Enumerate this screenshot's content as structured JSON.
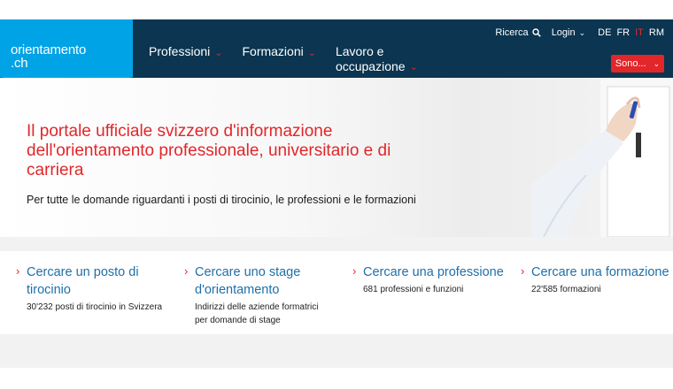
{
  "header": {
    "logo_line1": "orientamento",
    "logo_line2": ".ch",
    "nav": [
      {
        "label": "Professioni"
      },
      {
        "label": "Formazioni"
      },
      {
        "label_line1": "Lavoro e",
        "label_line2": "occupazione"
      }
    ],
    "util": {
      "search_label": "Ricerca",
      "login_label": "Login",
      "languages": [
        "DE",
        "FR",
        "IT",
        "RM"
      ],
      "active_language": "IT"
    },
    "sono_label": "Sono...",
    "colors": {
      "nav_bg": "#0b3550",
      "logo_bg": "#00a3e6",
      "accent": "#e2262a",
      "link": "#1f6fa8"
    }
  },
  "hero": {
    "title": "Il portale ufficiale svizzero d'informazione dell'orientamento professionale, universitario e di carriera",
    "subtitle": "Per tutte le domande riguardanti i posti di tirocinio, le professioni e le formazioni"
  },
  "quicklinks": [
    {
      "title": "Cercare un posto di tirocinio",
      "desc": "30'232 posti di tirocinio in Svizzera"
    },
    {
      "title": "Cercare uno stage d'orientamento",
      "desc": "Indirizzi delle aziende formatrici per domande di stage"
    },
    {
      "title": "Cercare una professione",
      "desc": "681 professioni e funzioni"
    },
    {
      "title": "Cercare una formazione",
      "desc": "22'585 formazioni"
    }
  ]
}
